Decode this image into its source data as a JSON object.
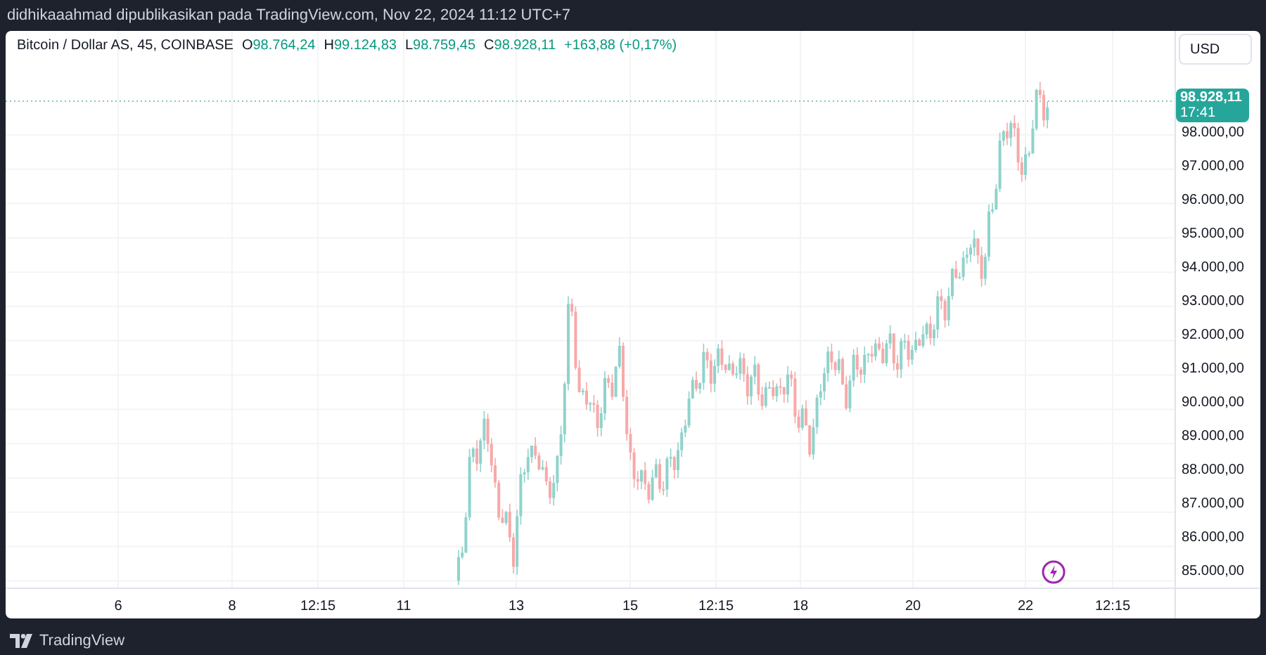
{
  "header": {
    "text": "didhikaaahmad dipublikasikan pada TradingView.com, Nov 22, 2024 11:12 UTC+7"
  },
  "legend": {
    "symbol": "Bitcoin / Dollar AS, 45, COINBASE",
    "ohlc": [
      {
        "label": "O",
        "value": "98.764,24"
      },
      {
        "label": "H",
        "value": "99.124,83"
      },
      {
        "label": "L",
        "value": "98.759,45"
      },
      {
        "label": "C",
        "value": "98.928,11"
      }
    ],
    "change": "+163,88 (+0,17%)"
  },
  "currency_button": "USD",
  "last_price": {
    "price": "98.928,11",
    "countdown": "17:41"
  },
  "price_axis": [
    "98.000,00",
    "97.000,00",
    "96.000,00",
    "95.000,00",
    "94.000,00",
    "93.000,00",
    "92.000,00",
    "91.000,00",
    "90.000,00",
    "89.000,00",
    "88.000,00",
    "87.000,00",
    "86.000,00",
    "85.000,00"
  ],
  "time_axis": [
    "6",
    "8",
    "12:15",
    "11",
    "13",
    "15",
    "12:15",
    "18",
    "20",
    "22",
    "12:15"
  ],
  "footer": {
    "brand": "TradingView"
  }
}
